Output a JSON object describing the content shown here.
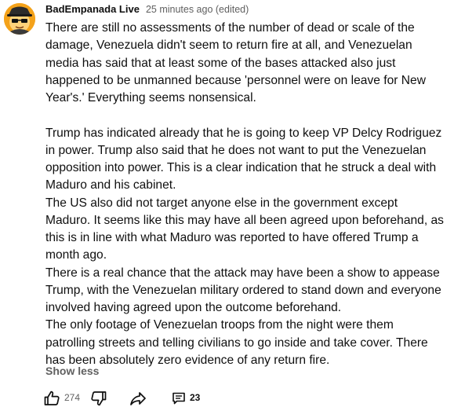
{
  "comment": {
    "author": "BadEmpanada Live",
    "timestamp": "25 minutes ago (edited)",
    "paragraphs": [
      "There are still no assessments of the number of dead or scale of the damage, Venezuela didn't seem to return fire at all, and Venezuelan media has said that at least some of the bases attacked also just happened to be unmanned because 'personnel were on leave for New Year's.' Everything seems nonsensical.",
      "Trump has indicated already that he is going to keep VP Delcy Rodriguez in power. Trump also said that he does not want to put the Venezuelan opposition into power. This is a clear indication that he struck a deal with Maduro and his cabinet.",
      "The US also did not target anyone else in the government except Maduro. It seems like this may have all been agreed upon beforehand, as this is in line with what Maduro was reported to have offered Trump a month ago.",
      "There is a real chance that the attack may have been a show to appease Trump, with the Venezuelan military ordered to stand down and everyone involved having agreed upon the outcome beforehand.",
      "The only footage of Venezuelan troops from the night were them patrolling streets and telling civilians to go inside and take cover. There has been absolutely zero evidence of any return fire."
    ],
    "show_less_label": "Show less",
    "like_count": "274",
    "reply_count": "23"
  },
  "icons": {
    "avatar": "avatar-spy-face",
    "like": "thumbs-up-icon",
    "dislike": "thumbs-down-icon",
    "share": "share-icon",
    "replies": "comment-bubble-icon"
  },
  "colors": {
    "text": "#0f0f0f",
    "secondary": "#606060",
    "avatar_bg": "#f4a21a"
  }
}
